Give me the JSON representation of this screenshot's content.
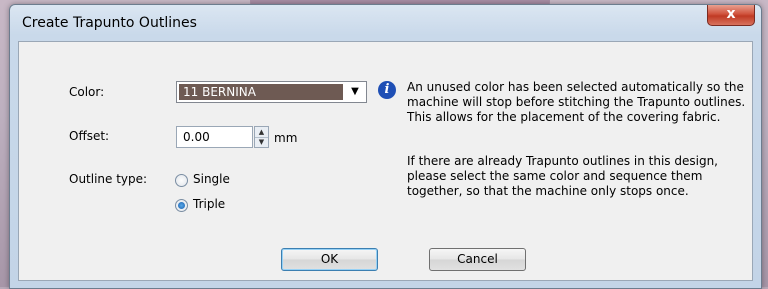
{
  "dialog": {
    "title": "Create Trapunto Outlines",
    "close_label": "x"
  },
  "form": {
    "color_label": "Color:",
    "color_value": "11 BERNINA",
    "color_swatch": "#6e5a53",
    "offset_label": "Offset:",
    "offset_value": "0.00",
    "offset_unit": "mm",
    "outline_type_label": "Outline type:",
    "outline_options": [
      {
        "label": "Single",
        "checked": false
      },
      {
        "label": "Triple",
        "checked": true
      }
    ]
  },
  "info": {
    "icon": "info-icon",
    "paragraph1": [
      "An unused color has been selected automatically so the",
      "machine will stop before stitching the Trapunto outlines.",
      "This allows for the placement of the covering fabric."
    ],
    "paragraph2": [
      "If there are already Trapunto outlines in this design,",
      "please select the same color and sequence them",
      "together, so that the machine only stops once."
    ]
  },
  "buttons": {
    "ok_label": "OK",
    "cancel_label": "Cancel"
  }
}
